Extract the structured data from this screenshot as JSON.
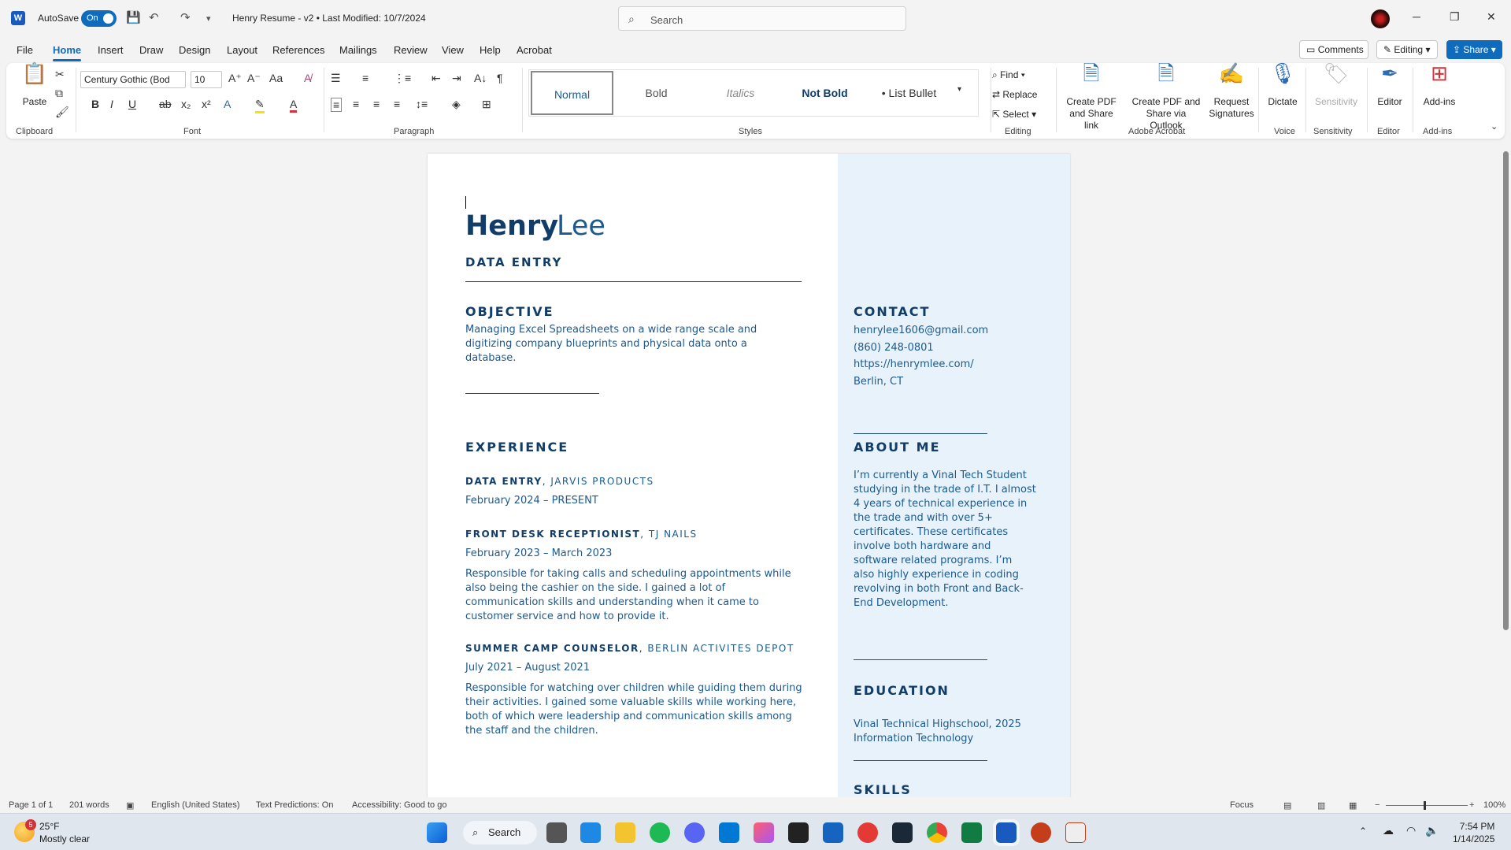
{
  "app": {
    "autosave_label": "AutoSave",
    "autosave_state": "On",
    "doc_title": "Henry Resume - v2  •  Last Modified: 10/7/2024",
    "search_placeholder": "Search"
  },
  "menu": {
    "tabs": [
      "File",
      "Home",
      "Insert",
      "Draw",
      "Design",
      "Layout",
      "References",
      "Mailings",
      "Review",
      "View",
      "Help",
      "Acrobat"
    ],
    "active": "Home",
    "comments_label": "Comments",
    "editing_label": "Editing",
    "share_label": "Share"
  },
  "ribbon": {
    "clipboard": {
      "paste_label": "Paste",
      "group_label": "Clipboard"
    },
    "font": {
      "font_name": "Century Gothic (Bod",
      "font_size": "10",
      "group_label": "Font"
    },
    "paragraph": {
      "group_label": "Paragraph"
    },
    "styles": {
      "items": [
        "Normal",
        "Bold",
        "Italics",
        "Not Bold",
        "• List Bullet"
      ],
      "group_label": "Styles"
    },
    "editing": {
      "find": "Find",
      "replace": "Replace",
      "select": "Select",
      "group_label": "Editing"
    },
    "acrobat": {
      "create_pdf": "Create PDF and Share link",
      "create_pdf_outlook": "Create PDF and Share via Outlook",
      "request_signatures": "Request Signatures",
      "group_label": "Adobe Acrobat"
    },
    "voice": {
      "dictate": "Dictate",
      "group_label": "Voice"
    },
    "sensitivity": {
      "label": "Sensitivity",
      "group_label": "Sensitivity"
    },
    "editor": {
      "label": "Editor",
      "group_label": "Editor"
    },
    "addins": {
      "label": "Add-ins",
      "group_label": "Add-ins"
    }
  },
  "resume": {
    "first_name": "Henry",
    "last_name": "Lee",
    "role": "DATA ENTRY",
    "objective_heading": "OBJECTIVE",
    "objective_text": "Managing Excel Spreadsheets on a wide range scale and digitizing company blueprints and physical data onto a database.",
    "experience_heading": "EXPERIENCE",
    "jobs": [
      {
        "title": "DATA ENTRY",
        "company": "JARVIS PRODUCTS",
        "dates": "February 2024 – PRESENT",
        "desc": ""
      },
      {
        "title": "FRONT DESK RECEPTIONIST",
        "company": "TJ NAILS",
        "dates": "February 2023 – March 2023",
        "desc": "Responsible for taking calls and scheduling appointments while also being the cashier on the side. I gained a lot of communication skills and understanding when it came to customer service and how to provide it."
      },
      {
        "title": "SUMMER CAMP COUNSELOR",
        "company": "BERLIN ACTIVITES DEPOT",
        "dates": "July 2021 – August 2021",
        "desc": "Responsible for watching over children while guiding them during their activities. I gained some valuable skills while working here, both of which were leadership and communication skills among the staff and the children."
      }
    ],
    "contact_heading": "CONTACT",
    "contact": {
      "email": "henrylee1606@gmail.com",
      "phone": "(860) 248-0801",
      "website": "https://henrymlee.com/",
      "location": "Berlin, CT"
    },
    "about_heading": "ABOUT ME",
    "about_lines": [
      "I’m currently a Vinal Tech Student",
      "studying in the trade of I.T. I almost",
      "4 years of technical experience in",
      "the trade and with over 5+",
      "certificates. These certificates",
      "involve both hardware and",
      "software related programs. I’m",
      "also highly experience in coding",
      "revolving in both Front and Back-",
      "End Development."
    ],
    "education_heading": "EDUCATION",
    "education_school": "Vinal Technical Highschool, 2025",
    "education_program": "Information Technology",
    "skills_heading": "SKILLS"
  },
  "status": {
    "page": "Page 1 of 1",
    "words": "201 words",
    "language": "English (United States)",
    "predictions": "Text Predictions: On",
    "accessibility": "Accessibility: Good to go",
    "focus": "Focus",
    "zoom": "100%"
  },
  "taskbar": {
    "weather_temp": "25°F",
    "weather_desc": "Mostly clear",
    "weather_badge": "5",
    "search_label": "Search",
    "time": "7:54 PM",
    "date": "1/14/2025"
  },
  "colors": {
    "accent": "#0f6cbd",
    "resume_navy": "#123d69",
    "resume_blue": "#1c5a8f",
    "sidebar_bg": "#e7f2fb"
  }
}
